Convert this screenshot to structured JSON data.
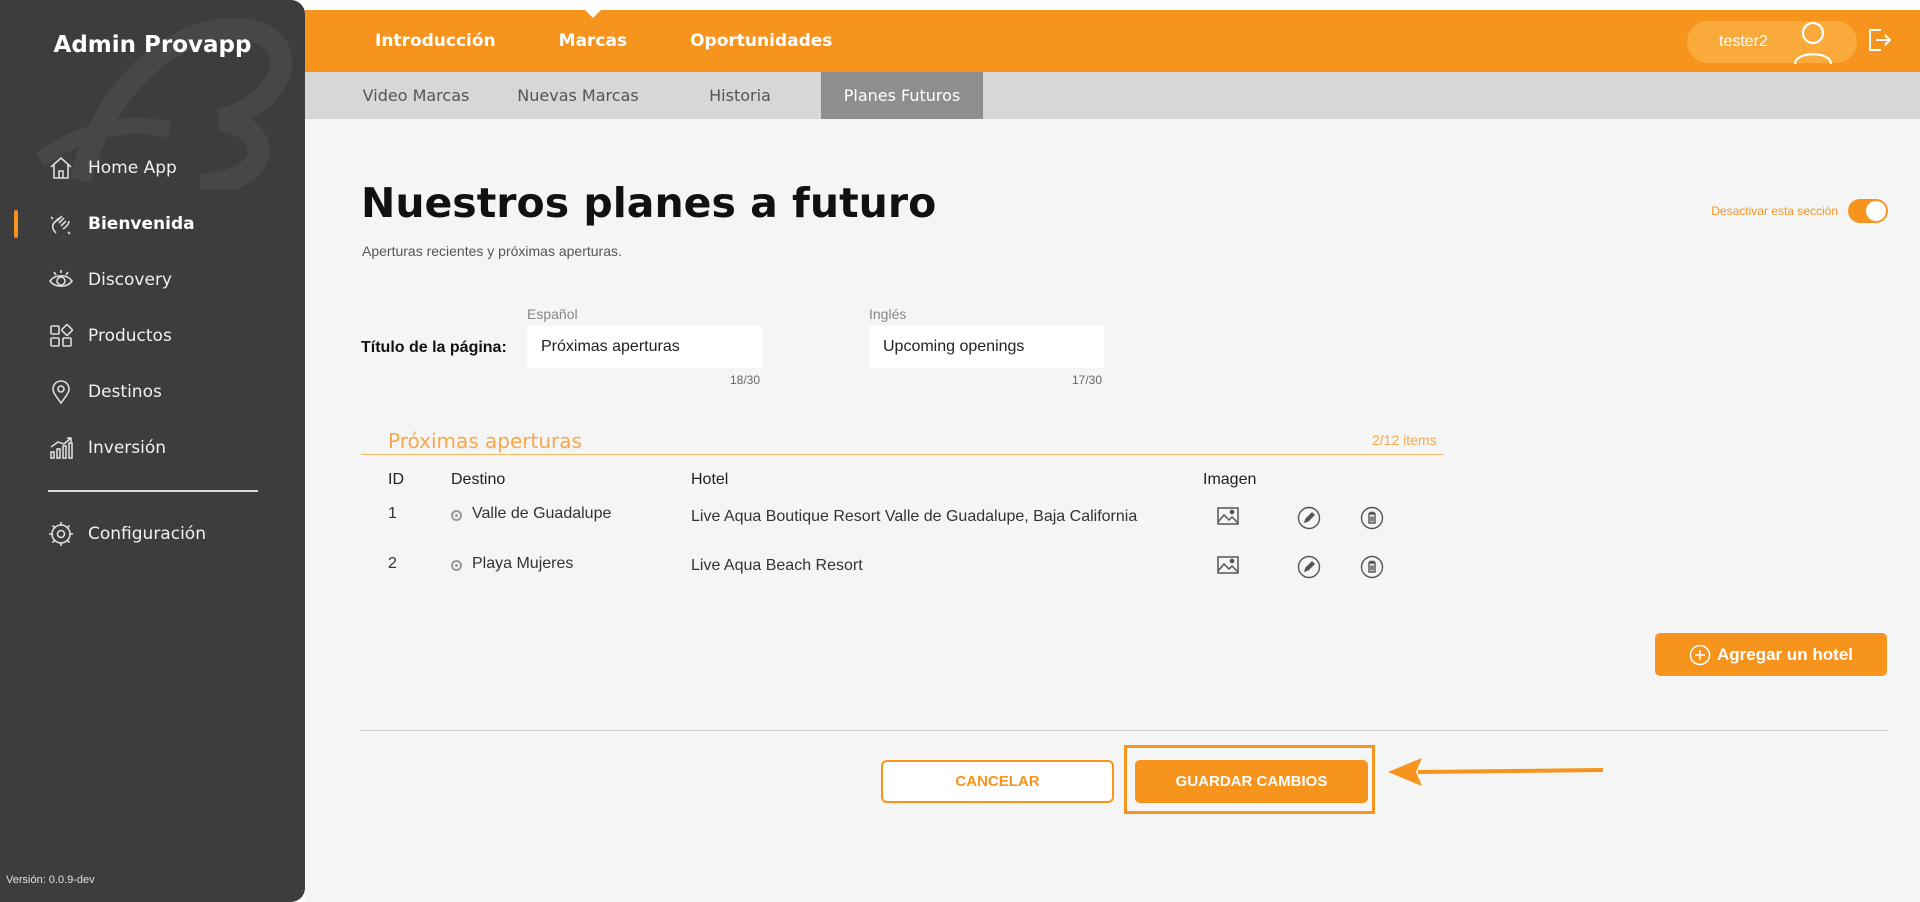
{
  "sidebar": {
    "brand": "Admin Provapp",
    "items": [
      {
        "label": "Home App",
        "icon": "home-icon"
      },
      {
        "label": "Bienvenida",
        "icon": "wave-hand-icon",
        "active": true
      },
      {
        "label": "Discovery",
        "icon": "eye-icon"
      },
      {
        "label": "Productos",
        "icon": "grid-icon"
      },
      {
        "label": "Destinos",
        "icon": "map-pin-icon"
      },
      {
        "label": "Inversión",
        "icon": "chart-icon"
      }
    ],
    "settings": {
      "label": "Configuración",
      "icon": "gear-icon"
    },
    "version": "Versión: 0.0.9-dev"
  },
  "topbar": {
    "tabs": [
      {
        "label": "Introducción"
      },
      {
        "label": "Marcas",
        "active": true
      },
      {
        "label": "Oportunidades"
      }
    ],
    "user": "tester2"
  },
  "subtabs": [
    {
      "label": "Video Marcas"
    },
    {
      "label": "Nuevas Marcas"
    },
    {
      "label": "Historia"
    },
    {
      "label": "Planes Futuros",
      "active": true
    }
  ],
  "main": {
    "title": "Nuestros planes a futuro",
    "subtitle": "Aperturas recientes y próximas aperturas.",
    "toggle_label": "Desactivar esta sección",
    "toggle_on": true,
    "page_title_label": "Título de la página:",
    "spanish": {
      "label": "Español",
      "value": "Próximas aperturas",
      "counter": "18/30"
    },
    "english": {
      "label": "Inglés",
      "value": "Upcoming openings",
      "counter": "17/30"
    },
    "section": {
      "title": "Próximas aperturas",
      "count": "2/12 items"
    },
    "table": {
      "headers": [
        "ID",
        "Destino",
        "Hotel",
        "Imagen"
      ],
      "rows": [
        {
          "id": "1",
          "destino": "Valle de Guadalupe",
          "hotel": "Live Aqua Boutique Resort Valle de Guadalupe, Baja California"
        },
        {
          "id": "2",
          "destino": "Playa Mujeres",
          "hotel": "Live Aqua Beach Resort"
        }
      ]
    },
    "add_button": "Agregar un hotel",
    "cancel_button": "CANCELAR",
    "save_button": "GUARDAR CAMBIOS"
  },
  "colors": {
    "accent": "#f7941d",
    "sidebar": "#3d3d3d",
    "subtab_active": "#8e8e8e"
  }
}
